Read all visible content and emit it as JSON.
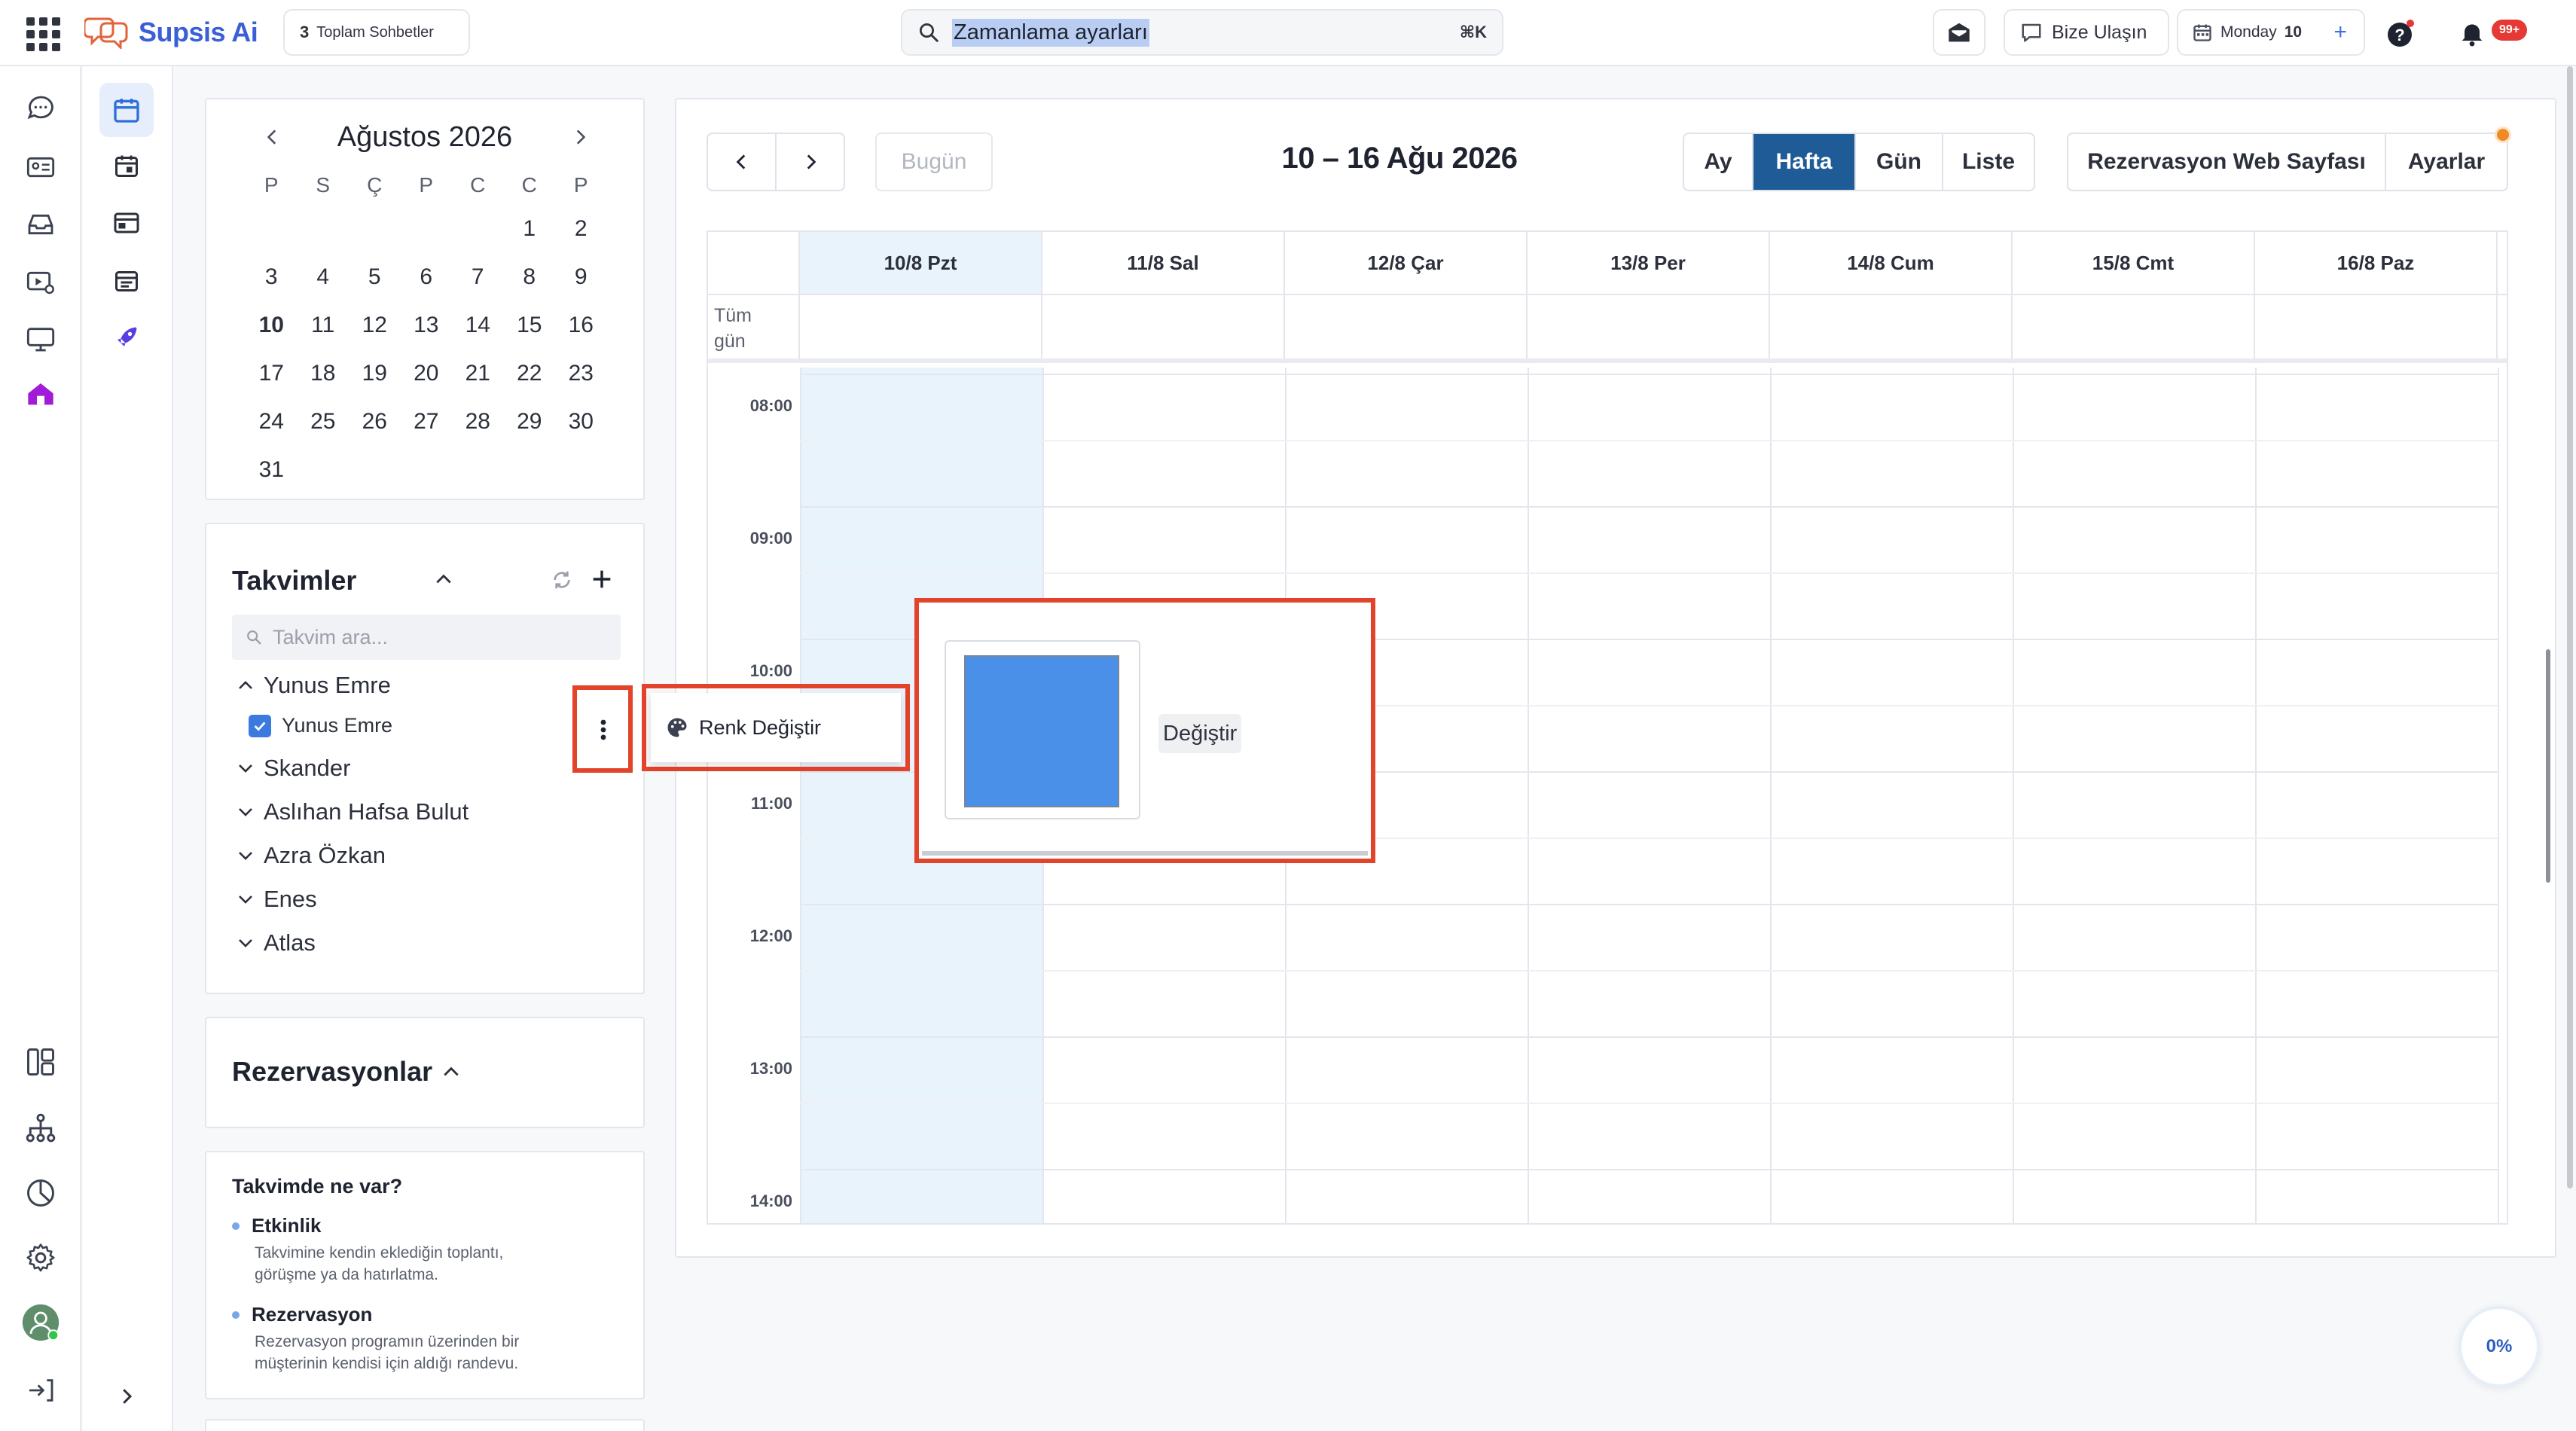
{
  "app": {
    "name": "Supsis Ai"
  },
  "header": {
    "conversation_count": "3",
    "conversation_label": "Toplam Sohbetler",
    "search_value": "Zamanlama ayarları",
    "search_shortcut": "⌘K",
    "contact_label": "Bize Ulaşın",
    "day_name": "Monday",
    "day_number": "10",
    "notification_badge": "99+"
  },
  "mini_calendar": {
    "title": "Ağustos 2026",
    "weekdays": [
      "P",
      "S",
      "Ç",
      "P",
      "C",
      "C",
      "P"
    ],
    "today": "10",
    "weeks": [
      [
        "",
        "",
        "",
        "",
        "",
        "1",
        "2"
      ],
      [
        "3",
        "4",
        "5",
        "6",
        "7",
        "8",
        "9"
      ],
      [
        "10",
        "11",
        "12",
        "13",
        "14",
        "15",
        "16"
      ],
      [
        "17",
        "18",
        "19",
        "20",
        "21",
        "22",
        "23"
      ],
      [
        "24",
        "25",
        "26",
        "27",
        "28",
        "29",
        "30"
      ],
      [
        "31",
        "",
        "",
        "",
        "",
        "",
        ""
      ]
    ]
  },
  "calendars": {
    "title": "Takvimler",
    "search_placeholder": "Takvim ara...",
    "owners": [
      "Yunus Emre",
      "Skander",
      "Aslıhan Hafsa Bulut",
      "Azra Özkan",
      "Enes",
      "Atlas"
    ],
    "sub_calendar": "Yunus Emre"
  },
  "reservations": {
    "title": "Rezervasyonlar"
  },
  "whats_in": {
    "title": "Takvimde ne var?",
    "items": [
      {
        "title": "Etkinlik",
        "desc_line1": "Takvimine kendin eklediğin toplantı,",
        "desc_line2": "görüşme ya da hatırlatma."
      },
      {
        "title": "Rezervasyon",
        "desc_line1": "Rezervasyon programın üzerinden bir",
        "desc_line2": "müşterinin kendisi için aldığı randevu."
      }
    ]
  },
  "toolbar": {
    "today_label": "Bugün",
    "range_title": "10 – 16 Ağu 2026",
    "views": [
      "Ay",
      "Hafta",
      "Gün",
      "Liste"
    ],
    "active_view": "Hafta",
    "booking_page_label": "Rezervasyon Web Sayfası",
    "settings_label": "Ayarlar"
  },
  "week": {
    "days": [
      "10/8 Pzt",
      "11/8 Sal",
      "12/8 Çar",
      "13/8 Per",
      "14/8 Cum",
      "15/8 Cmt",
      "16/8 Paz"
    ],
    "allday_line1": "Tüm",
    "allday_line2": "gün",
    "times": [
      "08:00",
      "09:00",
      "10:00",
      "11:00",
      "12:00",
      "13:00",
      "14:00"
    ]
  },
  "context_menu": {
    "change_color_label": "Renk Değiştir"
  },
  "color_picker": {
    "current_color": "#4a90e8",
    "change_label": "Değiştir"
  },
  "progress": {
    "value": "0%"
  },
  "colors": {
    "brand": "#3a5fd6",
    "active_view": "#1f5b96",
    "highlight": "#e2432a",
    "today_column": "#e9f3fc"
  }
}
